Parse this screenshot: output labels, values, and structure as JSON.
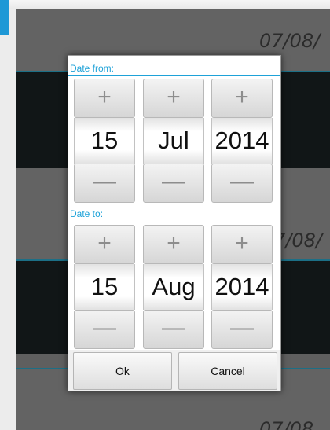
{
  "background": {
    "dates": [
      "07/08/",
      "7/08/",
      "07/08"
    ]
  },
  "dialog": {
    "date_from": {
      "label": "Date from:",
      "day": "15",
      "month": "Jul",
      "year": "2014"
    },
    "date_to": {
      "label": "Date to:",
      "day": "15",
      "month": "Aug",
      "year": "2014"
    },
    "plus_symbol": "+",
    "minus_symbol": "—",
    "ok_label": "Ok",
    "cancel_label": "Cancel"
  },
  "colors": {
    "accent": "#1e98d6",
    "label_blue": "#1ea2d8"
  }
}
